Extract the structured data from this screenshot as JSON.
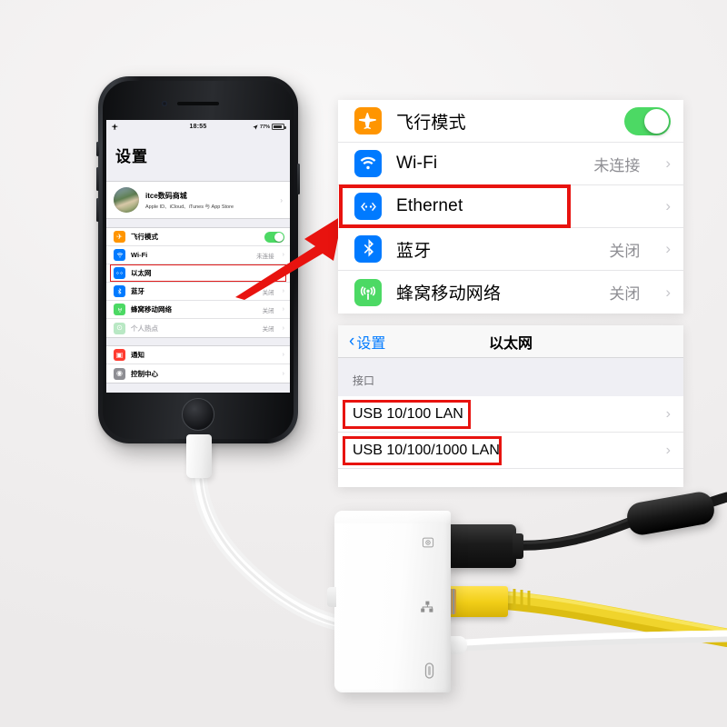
{
  "background_color": "#f2f0f0",
  "phone": {
    "status_bar": {
      "airplane_icon": "airplane-icon",
      "time": "18:55",
      "location_icon": "location-arrow-icon",
      "battery_percent": "77%"
    },
    "title": "设置",
    "account": {
      "name": "itce数码商城",
      "subtitle": "Apple ID、iCloud、iTunes 与 App Store",
      "chevron": "›"
    },
    "rows_group1": [
      {
        "icon": "airplane-icon",
        "icon_color": "#ff9500",
        "glyph": "✈",
        "label": "飞行模式",
        "control": "toggle",
        "toggle_on": true
      },
      {
        "icon": "wifi-icon",
        "icon_color": "#007aff",
        "glyph": "▲",
        "label": "Wi-Fi",
        "value": "未连接",
        "chevron": "›"
      },
      {
        "icon": "ethernet-icon",
        "icon_color": "#007aff",
        "glyph": "‹··›",
        "label": "以太网",
        "value": "",
        "chevron": "›",
        "highlighted": true
      },
      {
        "icon": "bluetooth-icon",
        "icon_color": "#007aff",
        "glyph": "✳",
        "label": "蓝牙",
        "value": "关闭",
        "chevron": "›"
      },
      {
        "icon": "cellular-icon",
        "icon_color": "#4cd964",
        "glyph": "((•))",
        "label": "蜂窝移动网络",
        "value": "关闭",
        "chevron": "›"
      },
      {
        "icon": "hotspot-icon",
        "icon_color": "#b9e8c4",
        "glyph": "⊙",
        "label": "个人热点",
        "value": "关闭",
        "chevron": "›",
        "dimmed": true
      }
    ],
    "rows_group2": [
      {
        "icon": "notifications-icon",
        "icon_color": "#ff3b30",
        "glyph": "▣",
        "label": "通知",
        "chevron": "›"
      },
      {
        "icon": "control-center-icon",
        "icon_color": "#8e8e93",
        "glyph": "◉",
        "label": "控制中心",
        "chevron": "›"
      }
    ]
  },
  "annotation": {
    "arrow_color": "#e8130f",
    "highlight_color": "#e8130f",
    "arrow_name": "red-pointer-arrow"
  },
  "panel_settings": {
    "rows": [
      {
        "icon": "airplane-icon",
        "icon_color": "#ff9500",
        "label": "飞行模式",
        "control": "toggle",
        "toggle_on": true,
        "toggle_color": "#4cd964",
        "value": "",
        "chevron": ""
      },
      {
        "icon": "wifi-icon",
        "icon_color": "#007aff",
        "label": "Wi-Fi",
        "control": "value",
        "value": "未连接",
        "chevron": "›"
      },
      {
        "icon": "ethernet-icon",
        "icon_color": "#007aff",
        "label": "Ethernet",
        "control": "value",
        "value": "",
        "chevron": "›",
        "highlighted": true
      },
      {
        "icon": "bluetooth-icon",
        "icon_color": "#007aff",
        "label": "蓝牙",
        "control": "value",
        "value": "关闭",
        "chevron": "›"
      },
      {
        "icon": "cellular-icon",
        "icon_color": "#4cd964",
        "label": "蜂窝移动网络",
        "control": "value",
        "value": "关闭",
        "chevron": "›"
      }
    ]
  },
  "panel_ethernet": {
    "nav": {
      "back_chevron": "‹",
      "back_label": "设置",
      "title": "以太网"
    },
    "section_header": "接口",
    "rows": [
      {
        "label": "USB 10/100 LAN",
        "chevron": "›",
        "highlighted": true
      },
      {
        "label": "USB 10/100/1000 LAN",
        "chevron": "›",
        "highlighted": true
      }
    ]
  },
  "hardware": {
    "adapter_label": "lightning-to-usb-ethernet-adapter",
    "ports": [
      {
        "name": "usb-port",
        "marking": "camera-icon"
      },
      {
        "name": "ethernet-port",
        "marking": "network-icon"
      },
      {
        "name": "lightning-port",
        "marking": "lightning-connector-icon"
      }
    ],
    "cables": [
      {
        "name": "usb-cable",
        "color": "#111111"
      },
      {
        "name": "ethernet-cable",
        "color": "#e8c51a"
      },
      {
        "name": "lightning-cable",
        "color": "#ffffff"
      }
    ]
  }
}
